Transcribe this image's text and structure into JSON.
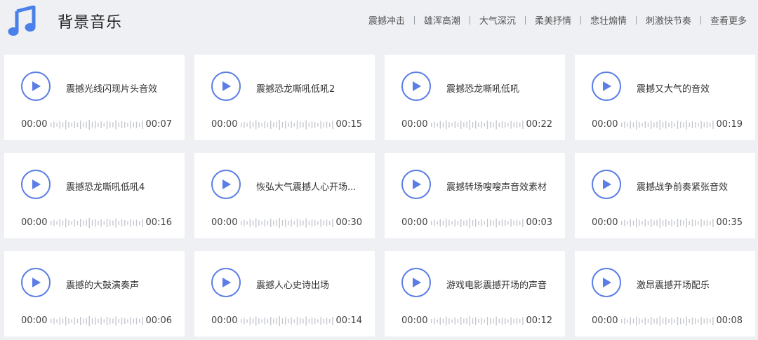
{
  "header": {
    "title": "背景音乐",
    "nav": [
      "震撼冲击",
      "雄浑高潮",
      "大气深沉",
      "柔美抒情",
      "悲壮煽情",
      "刺激快节奏",
      "查看更多"
    ]
  },
  "colors": {
    "accent": "#5b7ee6",
    "wave": "#c4c7ce",
    "background": "#eef0f4",
    "card": "#ffffff"
  },
  "icons": {
    "logo": "music-note-icon",
    "play": "play-icon"
  },
  "tracks": [
    {
      "title": "震撼光线闪现片头音效",
      "start": "00:00",
      "duration": "00:07"
    },
    {
      "title": "震撼恐龙嘶吼低吼2",
      "start": "00:00",
      "duration": "00:15"
    },
    {
      "title": "震撼恐龙嘶吼低吼",
      "start": "00:00",
      "duration": "00:22"
    },
    {
      "title": "震撼又大气的音效",
      "start": "00:00",
      "duration": "00:19"
    },
    {
      "title": "震撼恐龙嘶吼低吼4",
      "start": "00:00",
      "duration": "00:16"
    },
    {
      "title": "恢弘大气震撼人心开场...",
      "start": "00:00",
      "duration": "00:30"
    },
    {
      "title": "震撼转场嗖嗖声音效素材",
      "start": "00:00",
      "duration": "00:03"
    },
    {
      "title": "震撼战争前奏紧张音效",
      "start": "00:00",
      "duration": "00:35"
    },
    {
      "title": "震撼的大鼓演奏声",
      "start": "00:00",
      "duration": "00:06"
    },
    {
      "title": "震撼人心史诗出场",
      "start": "00:00",
      "duration": "00:14"
    },
    {
      "title": "游戏电影震撼开场的声音",
      "start": "00:00",
      "duration": "00:12"
    },
    {
      "title": "激昂震撼开场配乐",
      "start": "00:00",
      "duration": "00:08"
    }
  ]
}
